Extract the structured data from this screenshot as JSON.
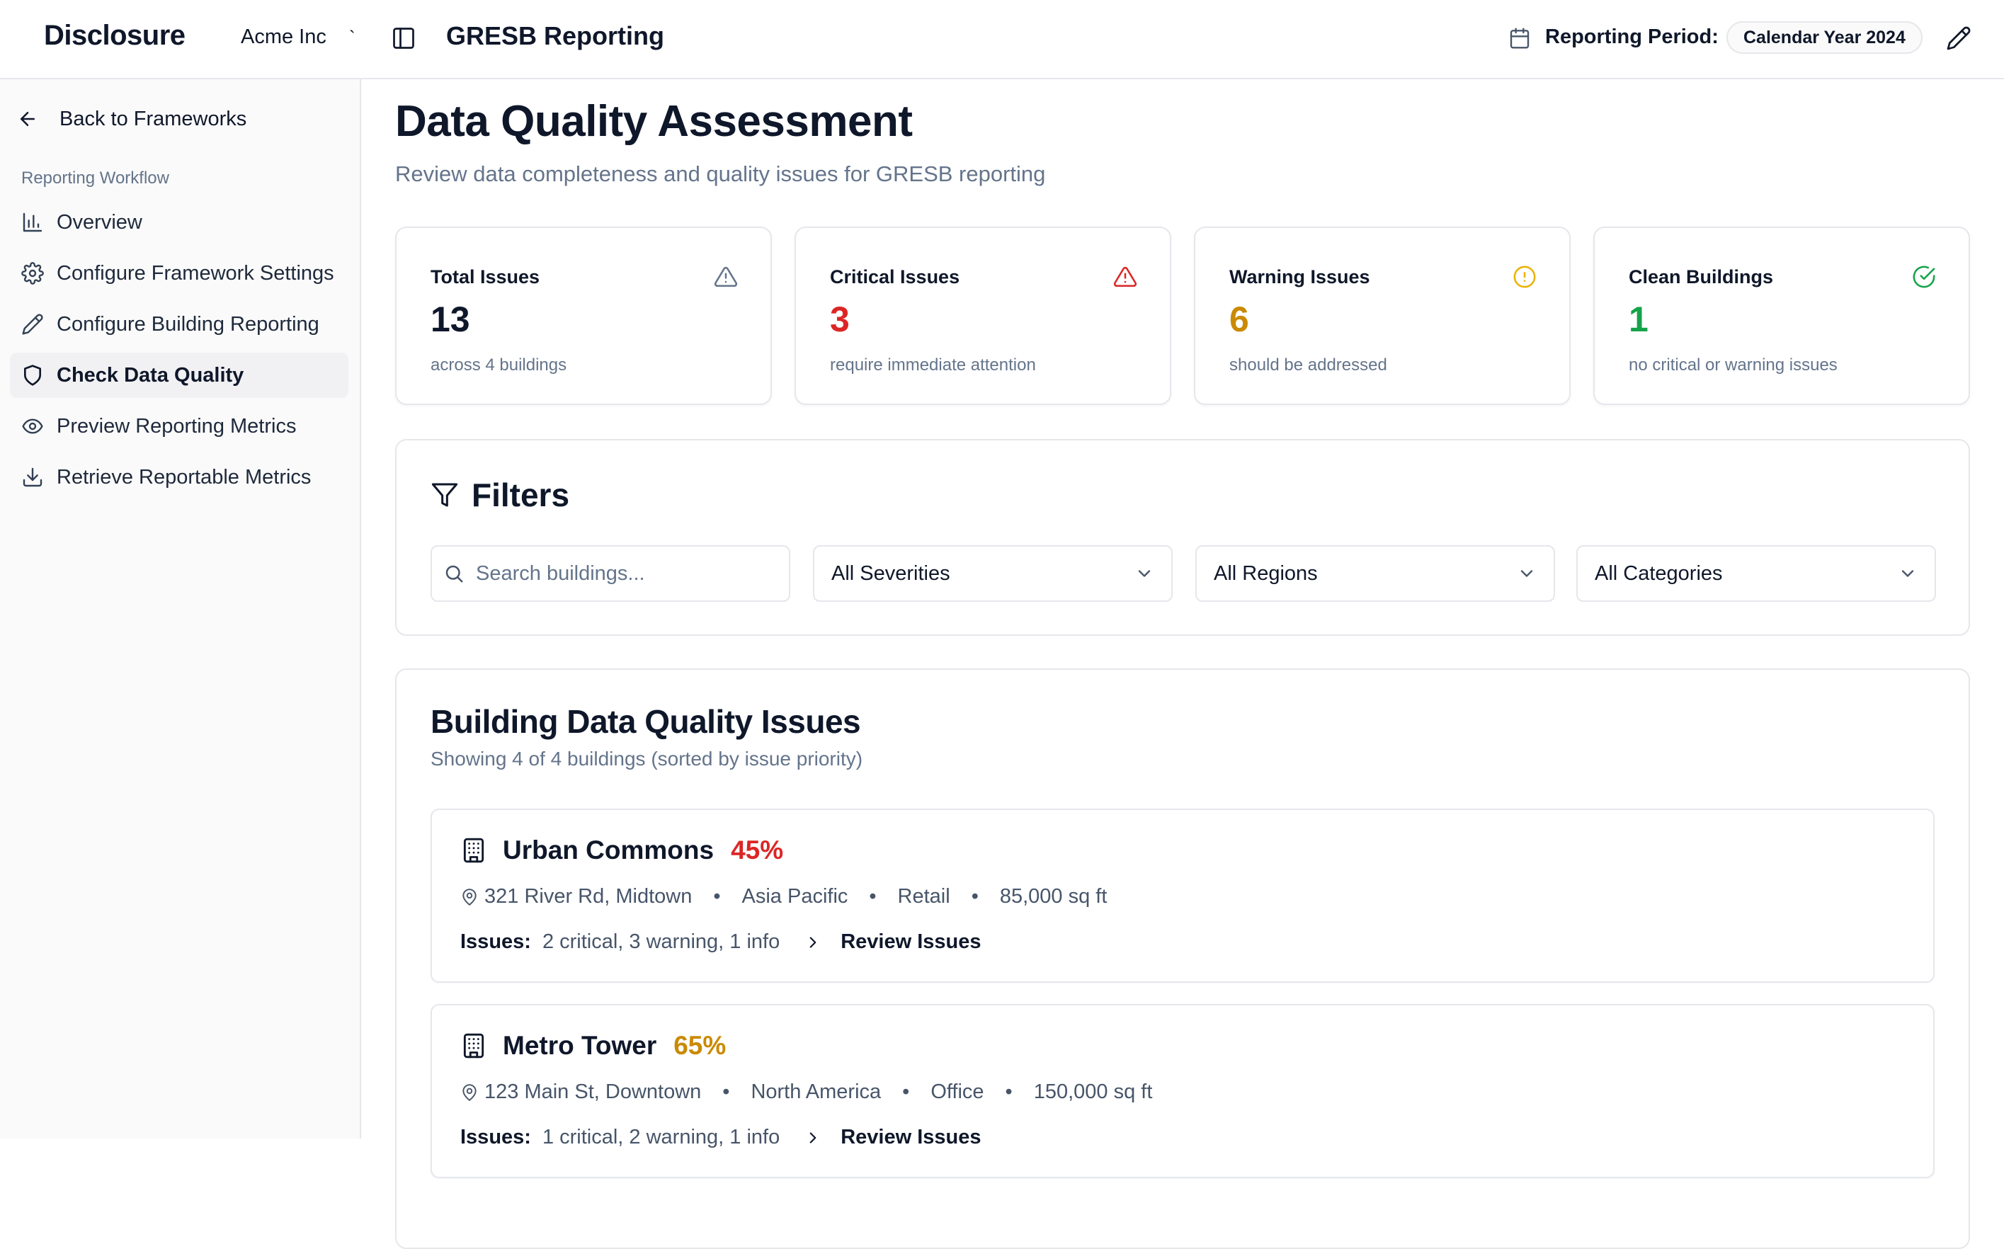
{
  "app": {
    "brand": "Disclosure",
    "org": "Acme Inc",
    "org_separator": "`",
    "title": "GRESB Reporting",
    "period_label": "Reporting Period:",
    "period_value": "Calendar Year 2024"
  },
  "sidebar": {
    "back_label": "Back to Frameworks",
    "section_heading": "Reporting Workflow",
    "items": [
      {
        "label": "Overview",
        "icon": "bar-chart-icon"
      },
      {
        "label": "Configure Framework Settings",
        "icon": "gear-icon"
      },
      {
        "label": "Configure Building Reporting",
        "icon": "pencil-icon"
      },
      {
        "label": "Check Data Quality",
        "icon": "shield-icon",
        "active": true
      },
      {
        "label": "Preview Reporting Metrics",
        "icon": "eye-icon"
      },
      {
        "label": "Retrieve Reportable Metrics",
        "icon": "download-icon"
      }
    ]
  },
  "main": {
    "title": "Data Quality Assessment",
    "subtitle": "Review data completeness and quality issues for GRESB reporting",
    "stats": [
      {
        "label": "Total Issues",
        "value": "13",
        "desc": "across 4 buildings",
        "color": "#0f172a",
        "icon": "warning-triangle-icon"
      },
      {
        "label": "Critical Issues",
        "value": "3",
        "desc": "require immediate attention",
        "color": "#dc2626",
        "icon": "alert-triangle-icon"
      },
      {
        "label": "Warning Issues",
        "value": "6",
        "desc": "should be addressed",
        "color": "#ca8a04",
        "icon": "alert-circle-icon"
      },
      {
        "label": "Clean Buildings",
        "value": "1",
        "desc": "no critical or warning issues",
        "color": "#16a34a",
        "icon": "check-circle-icon"
      }
    ],
    "filters": {
      "title": "Filters",
      "search_placeholder": "Search buildings...",
      "severity": "All Severities",
      "region": "All Regions",
      "category": "All Categories"
    },
    "issues": {
      "title": "Building Data Quality Issues",
      "subtitle": "Showing 4 of 4 buildings (sorted by issue priority)",
      "issues_label": "Issues:",
      "review_label": "Review Issues",
      "buildings": [
        {
          "name": "Urban Commons",
          "percent": "45%",
          "percent_color": "#dc2626",
          "address": "321 River Rd, Midtown",
          "region": "Asia Pacific",
          "type": "Retail",
          "area": "85,000 sq ft",
          "issue_counts": "2 critical, 3 warning, 1 info"
        },
        {
          "name": "Metro Tower",
          "percent": "65%",
          "percent_color": "#ca8a04",
          "address": "123 Main St, Downtown",
          "region": "North America",
          "type": "Office",
          "area": "150,000 sq ft",
          "issue_counts": "1 critical, 2 warning, 1 info"
        }
      ]
    }
  }
}
